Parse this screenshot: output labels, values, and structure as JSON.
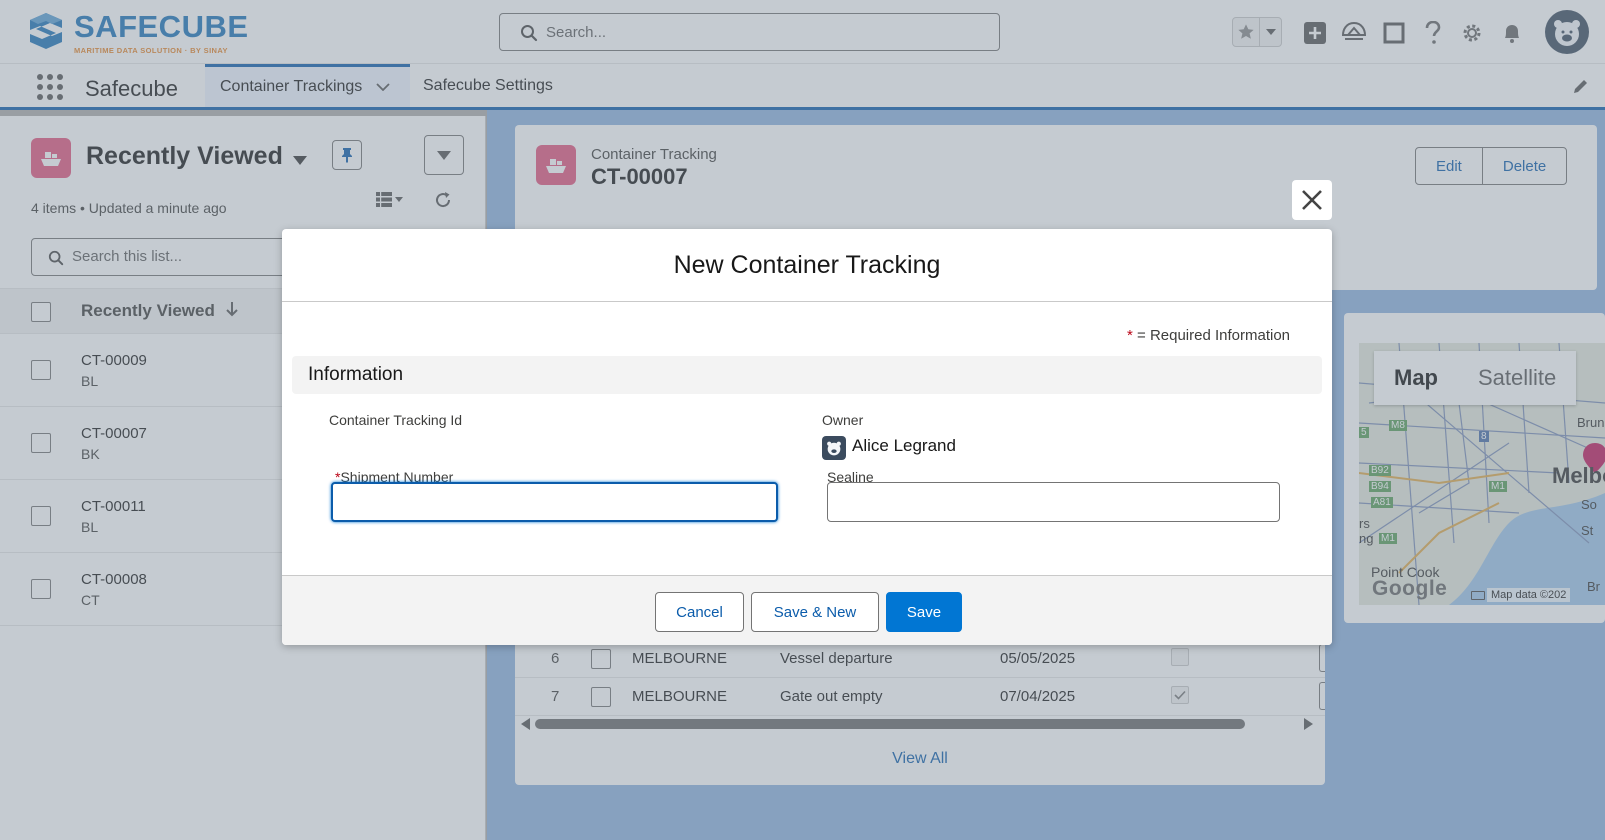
{
  "brand": {
    "name": "SAFECUBE",
    "tagline": "MARITIME DATA SOLUTION · BY SINAY",
    "accent_blue": "#1d73b8",
    "accent_orange": "#e8862a"
  },
  "header": {
    "search_placeholder": "Search...",
    "icons": [
      "star-icon",
      "chevron-down-icon",
      "plus-icon",
      "trailhead-icon",
      "square-icon",
      "help-icon",
      "gear-icon",
      "bell-icon",
      "user-avatar"
    ]
  },
  "nav": {
    "app_name": "Safecube",
    "tabs": [
      {
        "label": "Container Trackings",
        "active": true
      },
      {
        "label": "Safecube Settings",
        "active": false
      }
    ]
  },
  "list": {
    "title": "Recently Viewed",
    "meta": "4 items • Updated a minute ago",
    "search_placeholder": "Search this list...",
    "column_header": "Recently Viewed",
    "rows": [
      {
        "id": "CT-00009",
        "sub": "BL"
      },
      {
        "id": "CT-00007",
        "sub": "BK"
      },
      {
        "id": "CT-00011",
        "sub": "BL"
      },
      {
        "id": "CT-00008",
        "sub": "CT"
      }
    ]
  },
  "record": {
    "type_label": "Container Tracking",
    "name": "CT-00007",
    "actions": [
      "Edit",
      "Delete"
    ]
  },
  "map": {
    "toggle": [
      "Map",
      "Satellite"
    ],
    "city": "Melbo",
    "place": "Point Cook",
    "google": "Google",
    "attribution": "Map data ©202",
    "labels": [
      "Brunsw",
      "So",
      "St",
      "rs",
      "ng",
      "Br",
      "M8",
      "B92",
      "B94",
      "A81",
      "M1",
      "M1",
      "8",
      "5"
    ]
  },
  "events_table": {
    "rows": [
      {
        "num": "6",
        "location": "MELBOURNE",
        "event": "Vessel departure",
        "date": "05/05/2025",
        "checked": false
      },
      {
        "num": "7",
        "location": "MELBOURNE",
        "event": "Gate out empty",
        "date": "07/04/2025",
        "checked": true
      }
    ],
    "view_all": "View All"
  },
  "modal": {
    "title": "New Container Tracking",
    "required_star": "*",
    "required_legend": "= Required Information",
    "section": "Information",
    "fields": {
      "tracking_id_label": "Container Tracking Id",
      "owner_label": "Owner",
      "owner_name": "Alice Legrand",
      "shipment_label": "Shipment Number",
      "shipment_value": "",
      "sealine_label": "Sealine",
      "sealine_value": ""
    },
    "buttons": {
      "cancel": "Cancel",
      "save_new": "Save & New",
      "save": "Save"
    },
    "colors": {
      "brand_button": "#0176d3",
      "focus": "#0b5cab",
      "required": "#ba0517"
    }
  }
}
